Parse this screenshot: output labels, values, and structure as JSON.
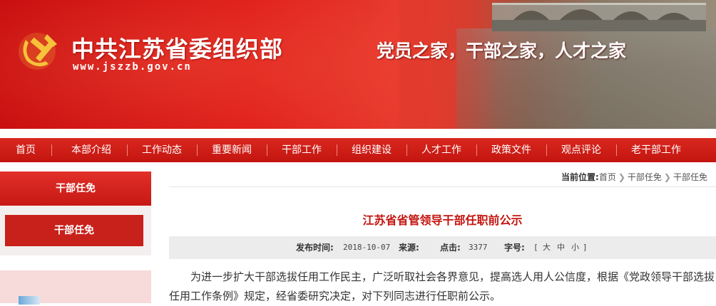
{
  "header": {
    "site_title": "中共江苏省委组织部",
    "site_url": "www.jszzb.gov.cn",
    "slogan": "党员之家，干部之家，人才之家",
    "emblem_icon": "party-emblem-icon",
    "brand_color": "#c3140f"
  },
  "nav": {
    "items": [
      "首页",
      "本部介绍",
      "工作动态",
      "重要新闻",
      "干部工作",
      "组织建设",
      "人才工作",
      "政策文件",
      "观点评论",
      "老干部工作"
    ]
  },
  "sidebar": {
    "heading": "干部任免",
    "active_item": "干部任免"
  },
  "breadcrumb": {
    "label": "当前位置:",
    "items": [
      "首页",
      "干部任免",
      "干部任免"
    ]
  },
  "article": {
    "title": "江苏省省管领导干部任职前公示",
    "meta": {
      "publish_label": "发布时间:",
      "publish_value": "2018-10-07",
      "source_label": "来源:",
      "source_value": "",
      "clicks_label": "点击:",
      "clicks_value": "3377",
      "font_label": "字号:",
      "font_open": "[",
      "font_large": "大",
      "font_medium": "中",
      "font_small": "小",
      "font_close": "]"
    },
    "body": "为进一步扩大干部选拔任用工作民主，广泛听取社会各界意见，提高选人用人公信度，根据《党政领导干部选拔任用工作条例》规定，经省委研究决定，对下列同志进行任职前公示。"
  }
}
